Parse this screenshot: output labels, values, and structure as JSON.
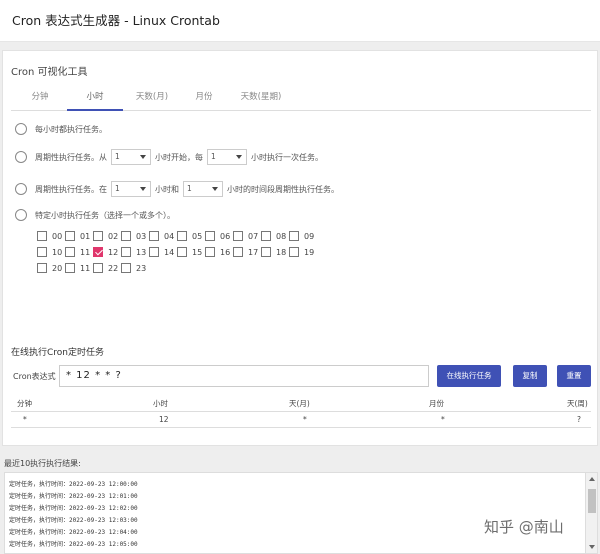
{
  "header": {
    "title": "Cron 表达式生成器 - Linux Crontab"
  },
  "tool": {
    "subtitle": "Cron 可视化工具",
    "tabs": [
      "分钟",
      "小时",
      "天数(月)",
      "月份",
      "天数(星期)"
    ],
    "active_tab": "小时"
  },
  "options": {
    "every": "每小时都执行任务。",
    "cycle": {
      "pre": "周期性执行任务。从",
      "start": "1",
      "mid": "小时开始，每",
      "step": "1",
      "post": "小时执行一次任务。"
    },
    "range": {
      "pre": "周期性执行任务。在",
      "from": "1",
      "mid": "小时和",
      "to": "1",
      "post": "小时的时间段周期性执行任务。"
    },
    "specific": "特定小时执行任务（选择一个或多个）。"
  },
  "hours": {
    "rows": [
      [
        "00",
        "01",
        "02",
        "03",
        "04",
        "05",
        "06",
        "07",
        "08",
        "09"
      ],
      [
        "10",
        "11",
        "12",
        "13",
        "14",
        "15",
        "16",
        "17",
        "18",
        "19"
      ],
      [
        "20",
        "11",
        "22",
        "23"
      ]
    ],
    "checked": "12",
    "checked_color": "#e0366c"
  },
  "online": {
    "title": "在线执行Cron定时任务",
    "expr_label": "Cron表达式",
    "expr_value": "* 12 * * ?",
    "buttons": {
      "run": "在线执行任务",
      "copy": "复制",
      "reset": "重置"
    },
    "accent": "#3f51b5"
  },
  "table": {
    "headers": [
      "分钟",
      "小时",
      "天(月)",
      "月份",
      "天(周)"
    ],
    "values": [
      "*",
      "12",
      "*",
      "*",
      "?"
    ]
  },
  "log": {
    "title": "最近10执行执行结果:",
    "lines": [
      "定时任务，执行时间：2022-09-23 12:00:00",
      "定时任务，执行时间：2022-09-23 12:01:00",
      "定时任务，执行时间：2022-09-23 12:02:00",
      "定时任务，执行时间：2022-09-23 12:03:00",
      "定时任务，执行时间：2022-09-23 12:04:00",
      "定时任务，执行时间：2022-09-23 12:05:00"
    ]
  },
  "watermark": "知乎 @南山"
}
